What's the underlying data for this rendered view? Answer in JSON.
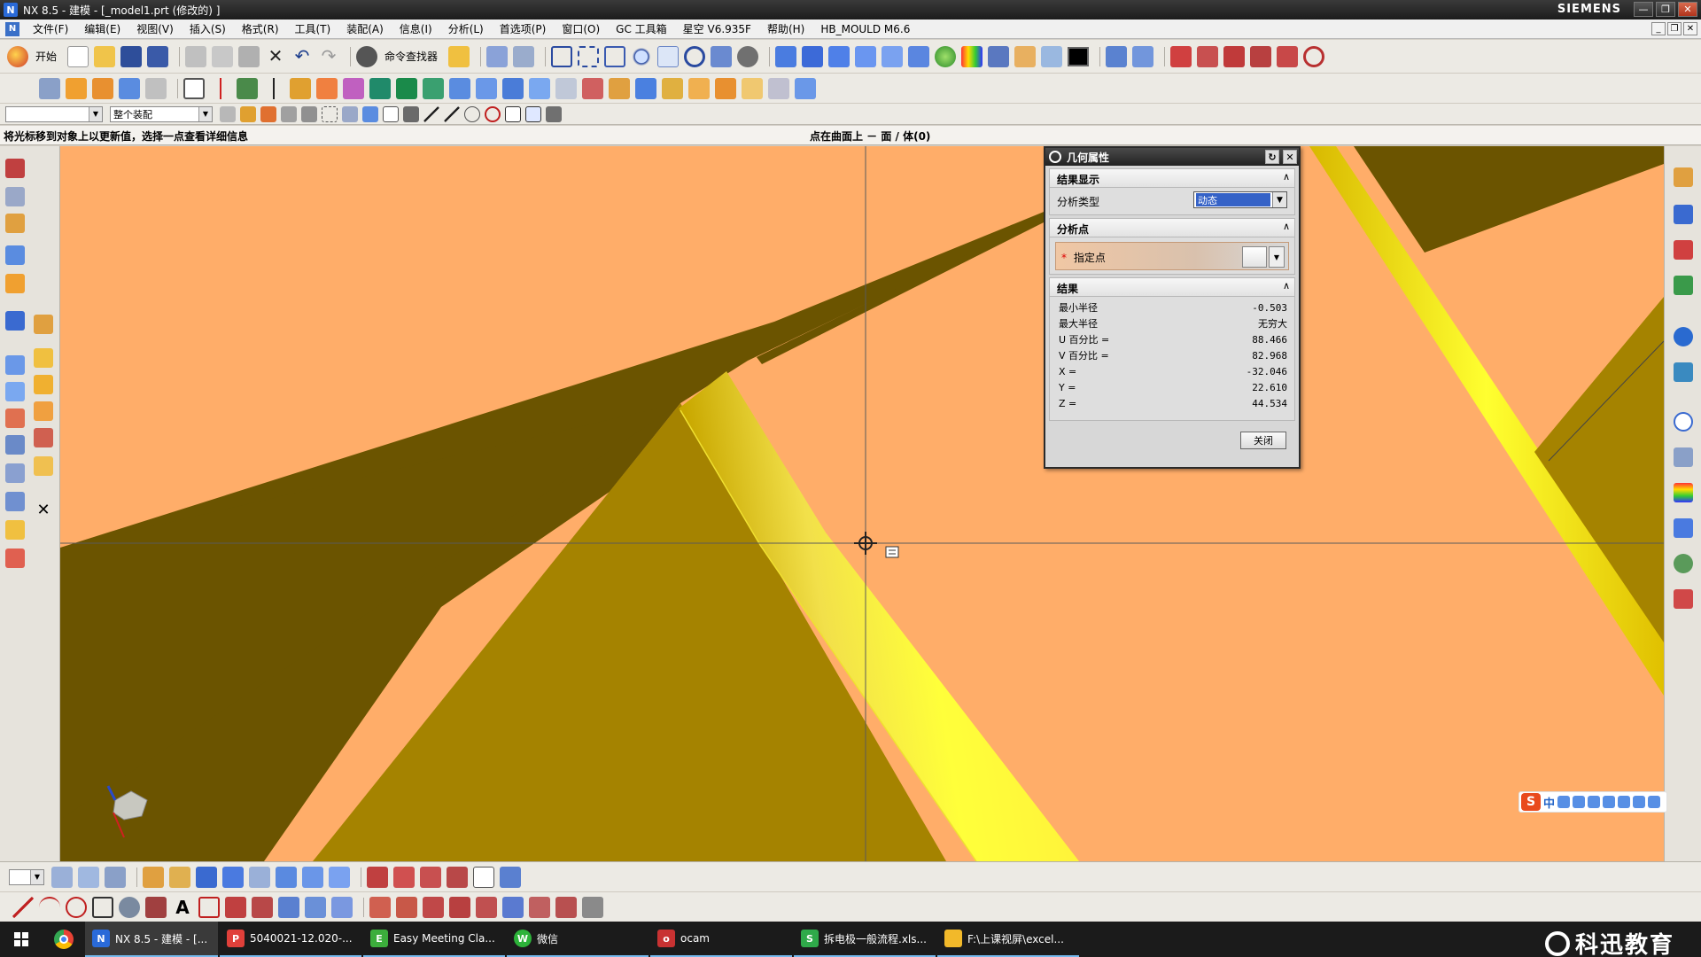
{
  "window": {
    "title": "NX 8.5 - 建模 - [_model1.prt  (修改的) ]",
    "brand": "SIEMENS",
    "buttons": [
      "—",
      "❐",
      "✕"
    ]
  },
  "menubar": {
    "items": [
      "文件(F)",
      "编辑(E)",
      "视图(V)",
      "插入(S)",
      "格式(R)",
      "工具(T)",
      "装配(A)",
      "信息(I)",
      "分析(L)",
      "首选项(P)",
      "窗口(O)",
      "GC 工具箱",
      "星空 V6.935F",
      "帮助(H)",
      "HB_MOULD M6.6"
    ]
  },
  "toolbar1": {
    "start_label": "开始",
    "command_finder_label": "命令查找器"
  },
  "toolbar3": {
    "filter_value": "",
    "assembly_scope": "整个装配"
  },
  "statusbar": {
    "prompt": "将光标移到对象上以更新值，选择一点查看详细信息",
    "status": "点在曲面上 － 面 / 体(0)"
  },
  "dialog": {
    "title": "几何属性",
    "section_display": "结果显示",
    "analysis_type_label": "分析类型",
    "analysis_type_value": "动态",
    "section_point": "分析点",
    "specify_point_label": "指定点",
    "section_results": "结果",
    "results": [
      {
        "label": "最小半径",
        "value": "-0.503"
      },
      {
        "label": "最大半径",
        "value": "无穷大"
      },
      {
        "label": "U 百分比 =",
        "value": "88.466"
      },
      {
        "label": "V 百分比 =",
        "value": "82.968"
      },
      {
        "label": "X =",
        "value": "-32.046"
      },
      {
        "label": "Y =",
        "value": "22.610"
      },
      {
        "label": "Z =",
        "value": "44.534"
      }
    ],
    "close_label": "关闭"
  },
  "ime": {
    "mode": "中"
  },
  "taskbar": {
    "items": [
      {
        "label": "NX 8.5 - 建模 - [...",
        "color": "#2a6ad8",
        "active": true
      },
      {
        "label": "5040021-12.020-...",
        "color": "#e0403a",
        "active": false
      },
      {
        "label": "Easy Meeting Cla...",
        "color": "#3cae3c",
        "active": false
      },
      {
        "label": "微信",
        "color": "#2db33a",
        "active": false
      },
      {
        "label": "ocam",
        "color": "#c83232",
        "active": false
      },
      {
        "label": "拆电极一般流程.xls...",
        "color": "#2faa4a",
        "active": false
      },
      {
        "label": "F:\\上课视屏\\excel...",
        "color": "#f2b92a",
        "active": false
      }
    ],
    "brand": "科迅教育"
  },
  "colors": {
    "viewport_bg": "#ffad69",
    "dark_olive": "#6b5400",
    "mid_olive": "#a68400",
    "bright_yellow": "#ffff2a",
    "accent_blue": "#3562c7"
  }
}
